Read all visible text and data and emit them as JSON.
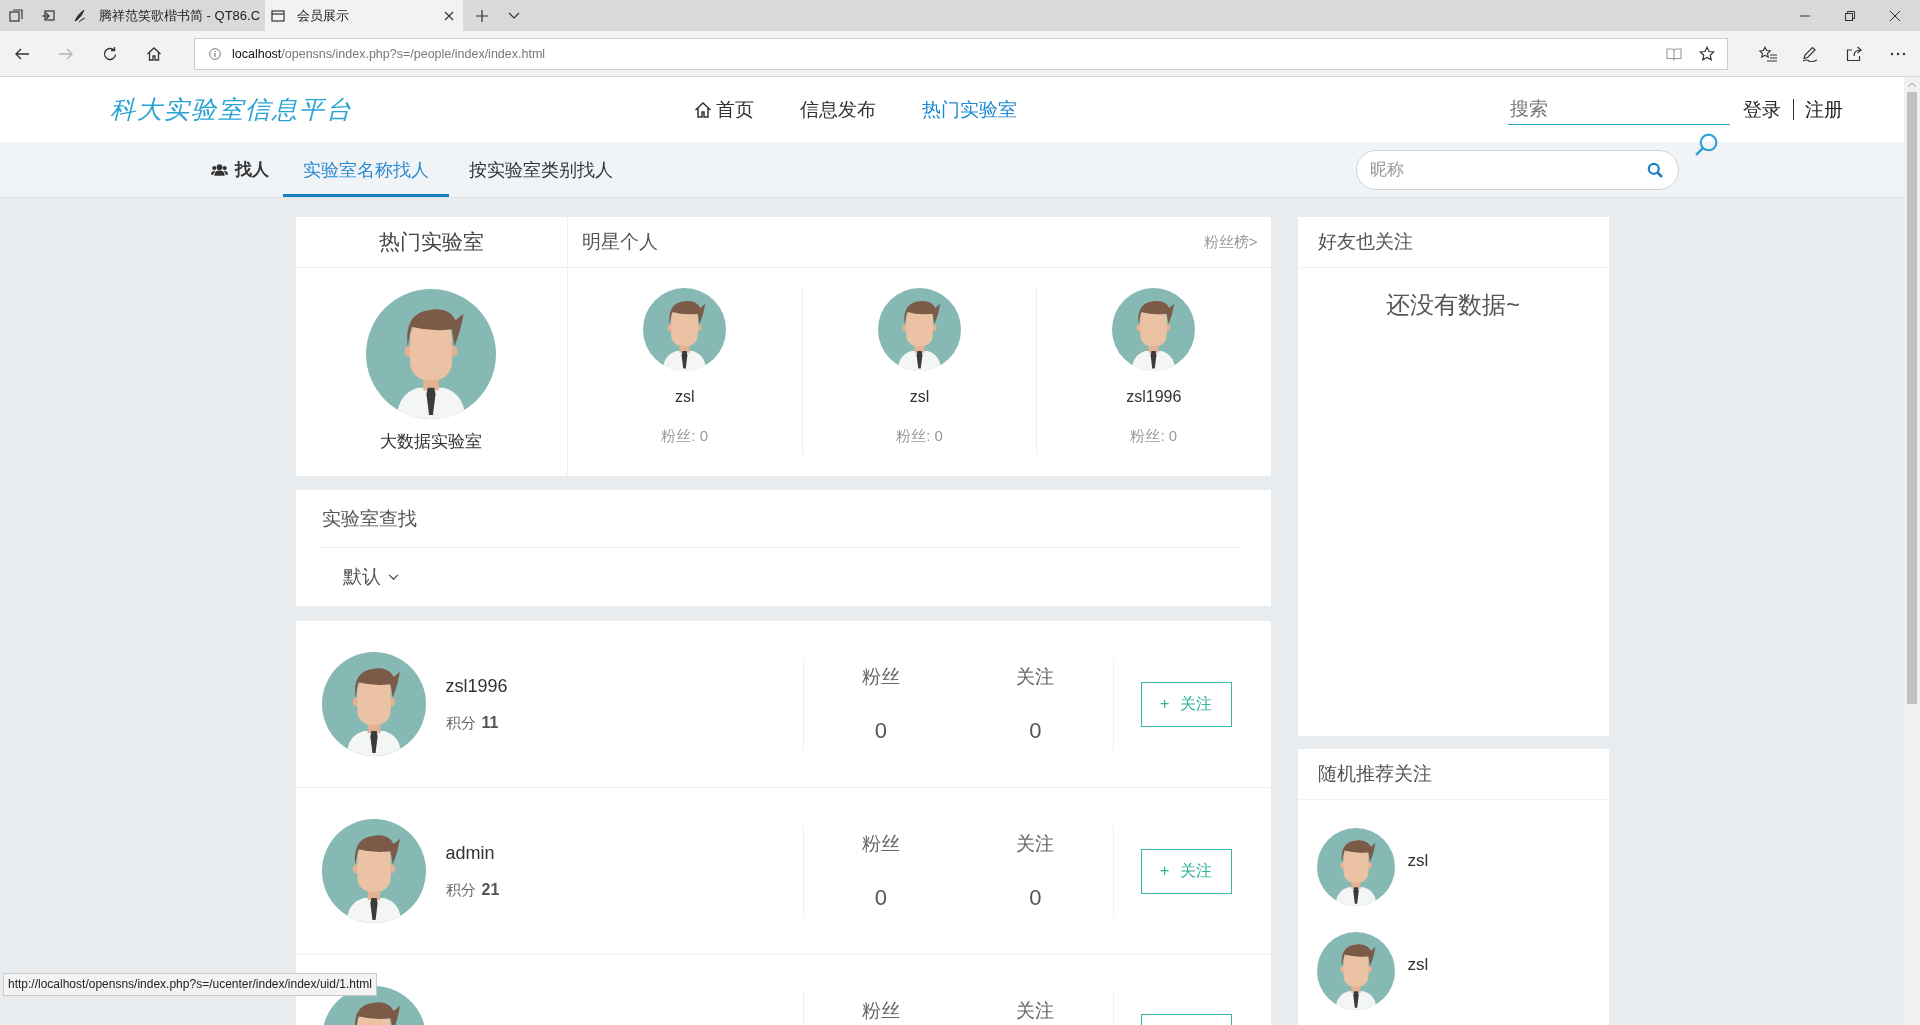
{
  "browser": {
    "tabs": [
      {
        "title": "腾祥范笑歌楷书简 - QT86.C",
        "selected": false
      },
      {
        "title": "会员展示",
        "selected": true
      }
    ],
    "forward_disabled": true,
    "url_host": "localhost",
    "url_path": "/opensns/index.php?s=/people/index/index.html"
  },
  "header": {
    "logo": "科大实验室信息平台",
    "nav": [
      {
        "label": "首页",
        "kind": "icon_link",
        "selected": false
      },
      {
        "label": "信息发布",
        "kind": "link",
        "selected": false
      },
      {
        "label": "热门实验室",
        "kind": "link",
        "selected": true
      }
    ],
    "search": {
      "placeholder": "搜索"
    },
    "login": "登录",
    "register": "注册"
  },
  "subnav": {
    "title": "找人",
    "tabs": [
      {
        "label": "实验室名称找人",
        "selected": true
      },
      {
        "label": "按实验室类别找人",
        "selected": false
      }
    ],
    "search": {
      "placeholder": "昵称"
    }
  },
  "hot_lab": {
    "title": "热门实验室",
    "name": "大数据实验室"
  },
  "stars": {
    "title": "明星个人",
    "more_link": "粉丝榜>",
    "people": [
      {
        "name": "zsl",
        "fans": "粉丝: 0"
      },
      {
        "name": "zsl",
        "fans": "粉丝: 0"
      },
      {
        "name": "zsl1996",
        "fans": "粉丝: 0"
      }
    ]
  },
  "lab_search": {
    "title": "实验室查找",
    "sort": "默认"
  },
  "members": [
    {
      "name": "zsl1996",
      "score_label": "积分",
      "score": "11",
      "fans_label": "粉丝",
      "fans": "0",
      "follow_label": "关注",
      "follow": "0",
      "button": "+ 关注"
    },
    {
      "name": "admin",
      "score_label": "积分",
      "score": "21",
      "fans_label": "粉丝",
      "fans": "0",
      "follow_label": "关注",
      "follow": "0",
      "button": "+ 关注"
    },
    {
      "fans_label": "粉丝",
      "follow_label": "关注"
    }
  ],
  "friends": {
    "title": "好友也关注",
    "empty_text": "还没有数据~"
  },
  "recommend": {
    "title": "随机推荐关注",
    "people": [
      {
        "name": "zsl"
      },
      {
        "name": "zsl"
      }
    ]
  },
  "status_url": "http://localhost/opensns/index.php?s=/ucenter/index/index/uid/1.html"
}
